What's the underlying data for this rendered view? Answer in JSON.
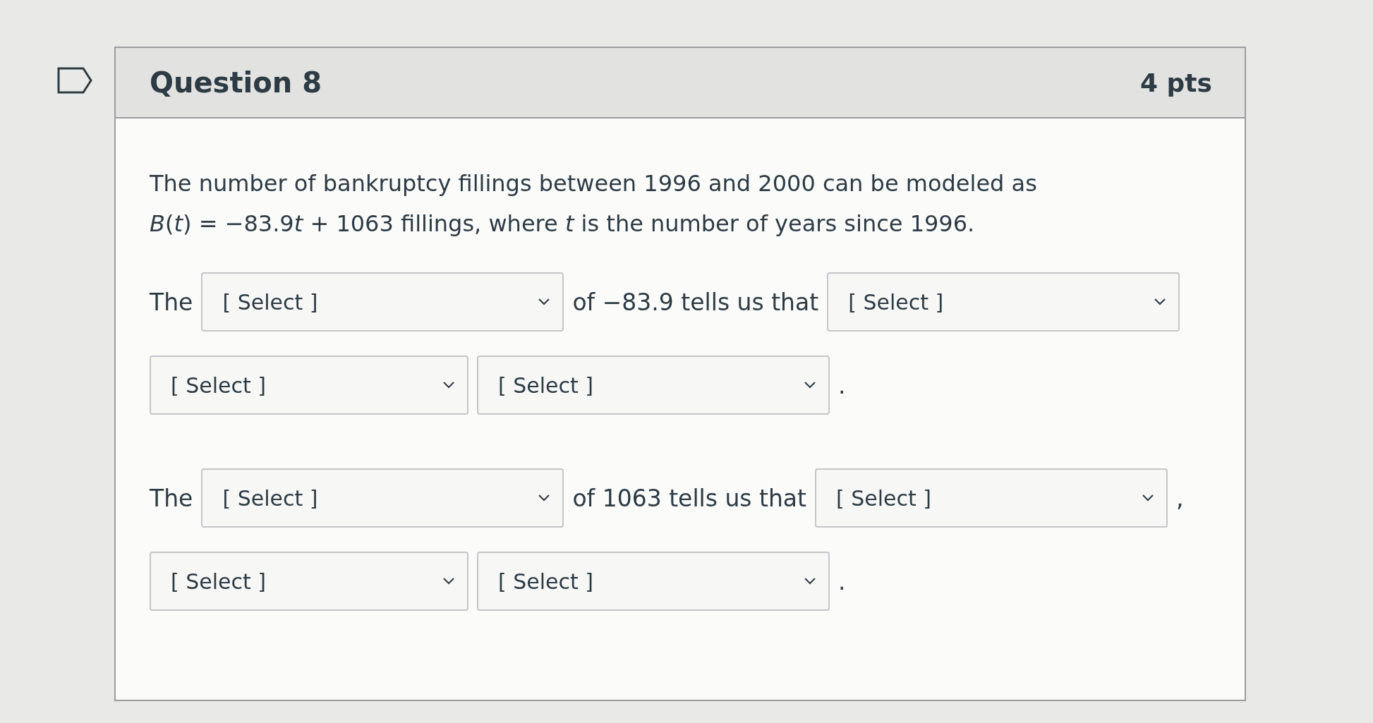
{
  "question": {
    "title": "Question 8",
    "points": "4 pts"
  },
  "prompt": [
    [
      "The number of bankruptcy fillings between 1996 and 2000 can be modeled as"
    ],
    [
      "*B*(*t*) = −83.9",
      "*t*",
      " + 1063 fillings, where *t* is the number of years since 1996."
    ]
  ],
  "rows": [
    {
      "items": [
        {
          "kind": "text",
          "text": "The"
        },
        {
          "kind": "select",
          "value": "[ Select ]"
        },
        {
          "kind": "text",
          "text": "of −83.9 tells us that"
        },
        {
          "kind": "select",
          "value": "[ Select ]"
        }
      ]
    },
    {
      "items": [
        {
          "kind": "select",
          "value": "[ Select ]"
        },
        {
          "kind": "select",
          "value": "[ Select ]"
        },
        {
          "kind": "text",
          "text": "."
        }
      ]
    },
    {
      "items": [
        {
          "kind": "text",
          "text": "The"
        },
        {
          "kind": "select",
          "value": "[ Select ]"
        },
        {
          "kind": "text",
          "text": "of 1063 tells us that"
        },
        {
          "kind": "select",
          "value": "[ Select ]"
        },
        {
          "kind": "text",
          "text": ","
        }
      ]
    },
    {
      "items": [
        {
          "kind": "select",
          "value": "[ Select ]"
        },
        {
          "kind": "select",
          "value": "[ Select ]"
        },
        {
          "kind": "text",
          "text": "."
        }
      ]
    }
  ]
}
